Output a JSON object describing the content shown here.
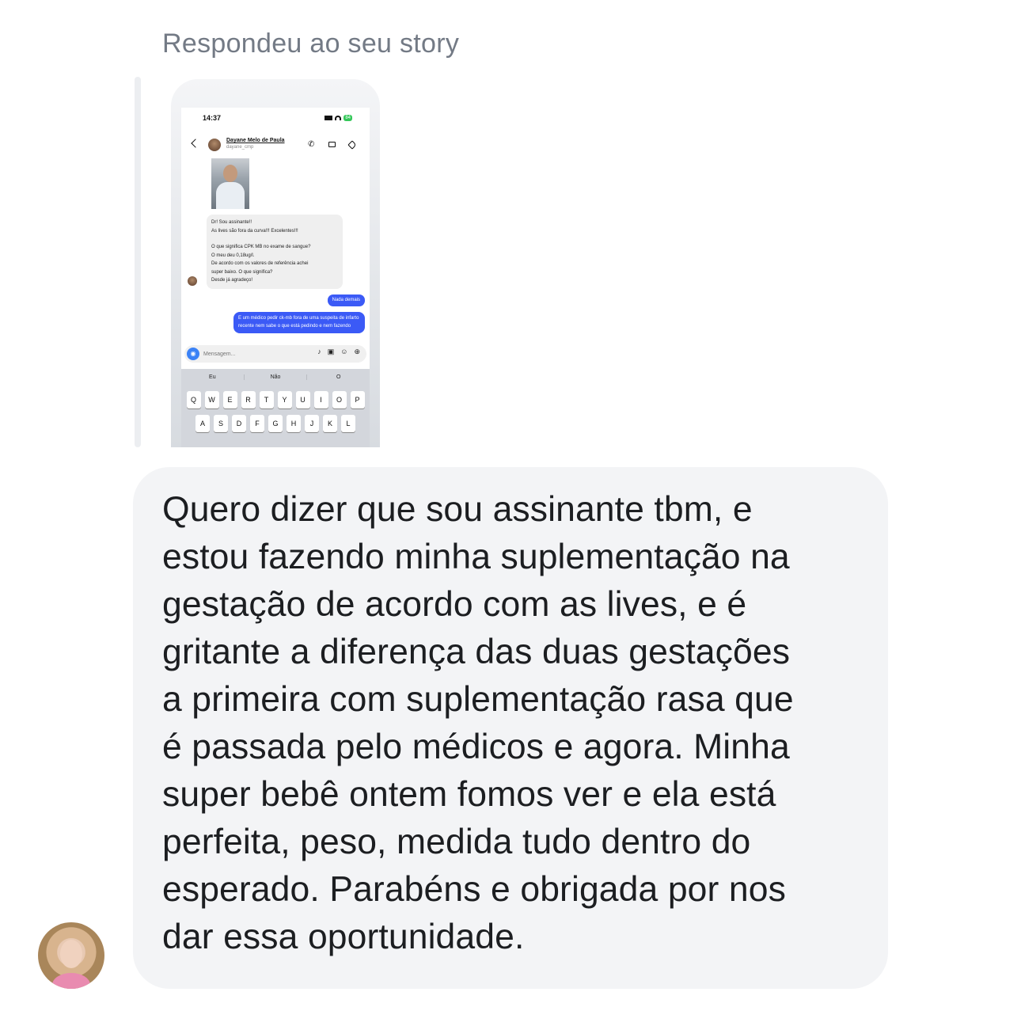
{
  "reply_context": {
    "label": "Respondeu ao seu story"
  },
  "story_preview": {
    "status_time": "14:37",
    "battery": "84",
    "contact_name": "Dayane Melo de Paula",
    "contact_username": "dayane_cmp",
    "incoming_message": [
      "Dr! Sou assinante!!",
      "As lives são fora da curva!!! Excelentes!!!",
      "",
      "O que significa CPK MB no exame de sangue?",
      "O meu deu 0,18ug/l.",
      "De acordo com os valores de referência achei",
      "super baixo. O que significa?",
      "Desde já agradeço!"
    ],
    "outgoing_short": "Nada demais",
    "outgoing_long": "E um médico pedir ck-mb fora de uma suspeita de infarto recente nem sabe o que está pedindo e nem fazendo",
    "composer_placeholder": "Mensagem...",
    "suggestions": [
      "Eu",
      "Não",
      "O"
    ],
    "keyboard_row1": [
      "Q",
      "W",
      "E",
      "R",
      "T",
      "Y",
      "U",
      "I",
      "O",
      "P"
    ],
    "keyboard_row2": [
      "A",
      "S",
      "D",
      "F",
      "G",
      "H",
      "J",
      "K",
      "L"
    ]
  },
  "message": {
    "text": "Quero dizer que sou assinante tbm, e\nestou fazendo minha suplementação na\ngestação de acordo com as lives, e é\ngritante a diferença das duas gestações\na primeira com suplementação rasa que\né passada pelo médicos e agora. Minha\nsuper bebê ontem fomos ver e ela está\nperfeita, peso, medida tudo dentro do\nesperado. Parabéns e obrigada por nos\ndar essa oportunidade."
  }
}
